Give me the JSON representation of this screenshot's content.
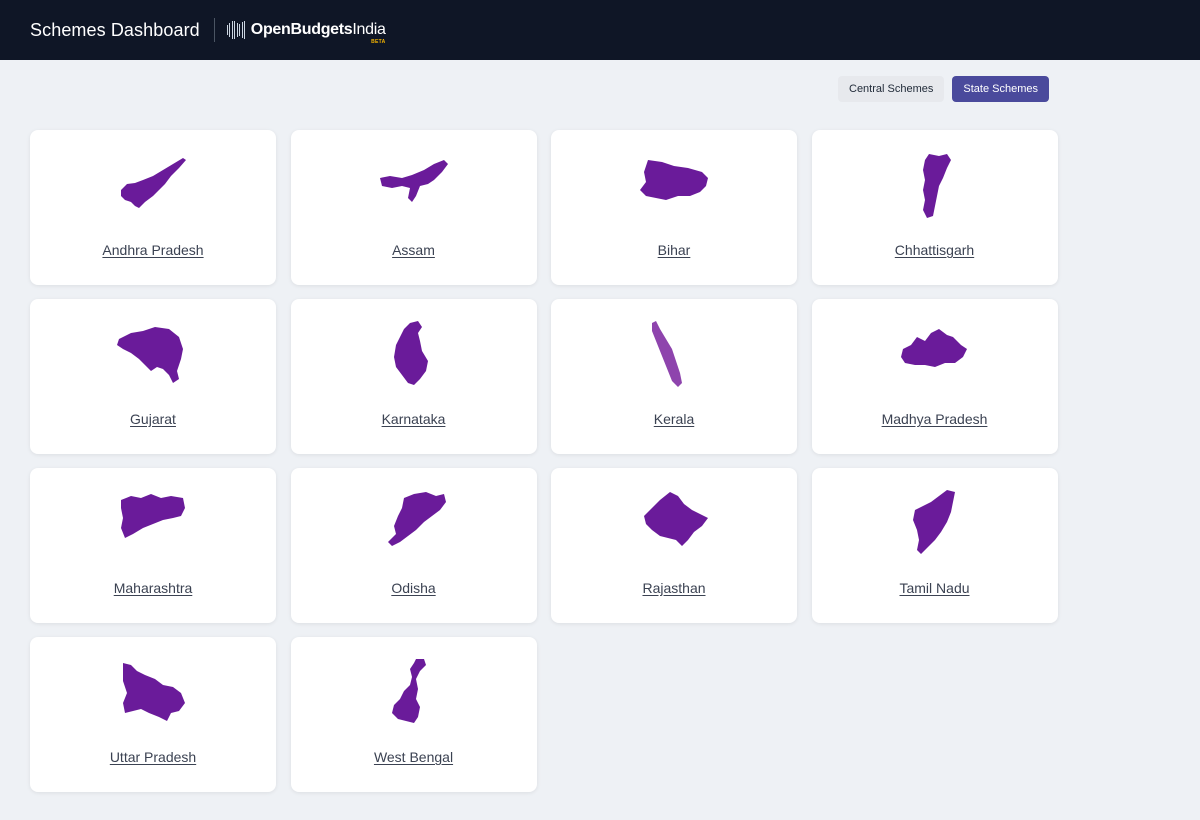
{
  "header": {
    "title": "Schemes Dashboard",
    "brand_bold": "OpenBudgets",
    "brand_light": "India",
    "brand_tag": "BETA"
  },
  "toggle": {
    "central_label": "Central Schemes",
    "state_label": "State Schemes",
    "selected": "State Schemes"
  },
  "colors": {
    "accent": "#4a4a9c",
    "map_fill": "#6a1b9a",
    "map_fill_light": "#8e44ad",
    "header_bg": "#0f1626"
  },
  "states": [
    {
      "name": "Andhra Pradesh",
      "icon": "andhra-pradesh-map-icon"
    },
    {
      "name": "Assam",
      "icon": "assam-map-icon"
    },
    {
      "name": "Bihar",
      "icon": "bihar-map-icon"
    },
    {
      "name": "Chhattisgarh",
      "icon": "chhattisgarh-map-icon"
    },
    {
      "name": "Gujarat",
      "icon": "gujarat-map-icon"
    },
    {
      "name": "Karnataka",
      "icon": "karnataka-map-icon"
    },
    {
      "name": "Kerala",
      "icon": "kerala-map-icon"
    },
    {
      "name": "Madhya Pradesh",
      "icon": "madhya-pradesh-map-icon"
    },
    {
      "name": "Maharashtra",
      "icon": "maharashtra-map-icon"
    },
    {
      "name": "Odisha",
      "icon": "odisha-map-icon"
    },
    {
      "name": "Rajasthan",
      "icon": "rajasthan-map-icon"
    },
    {
      "name": "Tamil Nadu",
      "icon": "tamil-nadu-map-icon"
    },
    {
      "name": "Uttar Pradesh",
      "icon": "uttar-pradesh-map-icon"
    },
    {
      "name": "West Bengal",
      "icon": "west-bengal-map-icon"
    }
  ]
}
